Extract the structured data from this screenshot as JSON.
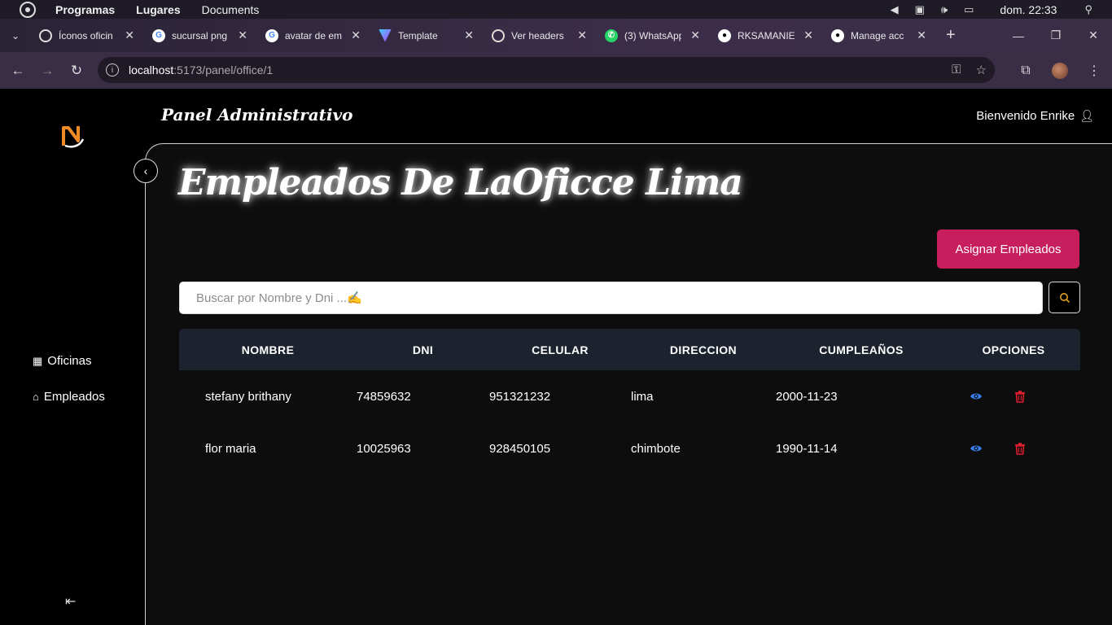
{
  "os": {
    "menu": [
      "Programas",
      "Lugares",
      "Documents"
    ],
    "clock": "dom. 22:33"
  },
  "browser": {
    "tabs": [
      {
        "title": "Íconos oficin",
        "icon": "openai-icon"
      },
      {
        "title": "sucursal png",
        "icon": "google-icon"
      },
      {
        "title": "avatar de em",
        "icon": "google-icon"
      },
      {
        "title": "Template",
        "icon": "vite-icon"
      },
      {
        "title": "Ver headers",
        "icon": "openai-icon"
      },
      {
        "title": "(3) WhatsApp",
        "icon": "whatsapp-icon"
      },
      {
        "title": "RKSAMANIE",
        "icon": "github-icon"
      },
      {
        "title": "Manage acc",
        "icon": "github-icon"
      }
    ],
    "url_host": "localhost",
    "url_path": ":5173/panel/office/1"
  },
  "header": {
    "title": "Panel Administrativo",
    "welcome": "Bienvenido Enrike"
  },
  "sidebar": {
    "items": [
      {
        "label": "Oficinas",
        "icon": "building-icon"
      },
      {
        "label": "Empleados",
        "icon": "home-icon"
      }
    ]
  },
  "main": {
    "title": "Empleados De LaOficce Lima",
    "assign_button": "Asignar Empleados",
    "search_placeholder": "Buscar por Nombre y Dni ...✍️"
  },
  "table": {
    "columns": [
      "NOMBRE",
      "DNI",
      "CELULAR",
      "DIRECCION",
      "CUMPLEAÑOS",
      "OPCIONES"
    ],
    "rows": [
      {
        "nombre": "stefany brithany",
        "dni": "74859632",
        "celular": "951321232",
        "direccion": "lima",
        "cumpleanos": "2000-11-23"
      },
      {
        "nombre": "flor maria",
        "dni": "10025963",
        "celular": "928450105",
        "direccion": "chimbote",
        "cumpleanos": "1990-11-14"
      }
    ]
  },
  "colors": {
    "accent": "#c71e5e",
    "header_bg": "#1c222e",
    "view_icon": "#3b82f6",
    "delete_icon": "#e11d2e"
  }
}
